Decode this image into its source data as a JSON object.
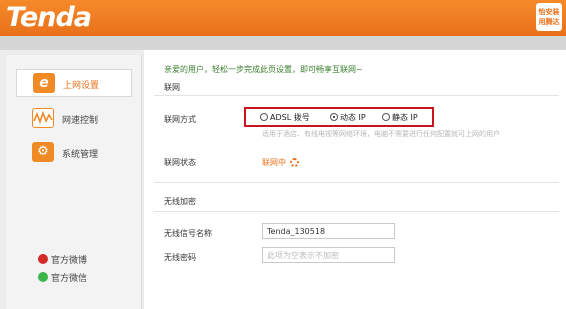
{
  "header": {
    "logo": "Tenda",
    "badge_line1": "怡安装",
    "badge_line2": "用腾达"
  },
  "sidebar": {
    "items": [
      {
        "label": "上网设置",
        "icon": "internet-e-icon",
        "active": true
      },
      {
        "label": "网速控制",
        "icon": "speed-wave-icon",
        "active": false
      },
      {
        "label": "系统管理",
        "icon": "gear-icon",
        "active": false
      }
    ],
    "social": [
      {
        "label": "官方微博",
        "icon": "weibo-icon",
        "color": "#d52a2a"
      },
      {
        "label": "官方微信",
        "icon": "wechat-icon",
        "color": "#3bb54a"
      }
    ]
  },
  "main": {
    "greeting": "亲爱的用户，轻松一步完成此页设置，即可畅享互联网~",
    "internet_section": "联网",
    "connection_label": "联网方式",
    "options": [
      {
        "label": "ADSL 拨号",
        "selected": false
      },
      {
        "label": "动态 IP",
        "selected": true
      },
      {
        "label": "静态 IP",
        "selected": false
      }
    ],
    "hint": "适用于酒店、有线电视等网络环境，电脑不需要进行任何配置就可上网的用户",
    "status_label": "联网状态",
    "status_value": "联网中",
    "wireless_section": "无线加密",
    "ssid_label": "无线信号名称",
    "ssid_value": "Tenda_130518",
    "password_label": "无线密码",
    "password_placeholder": "此项为空表示不加密"
  },
  "colors": {
    "brand": "#e9701a",
    "highlight_border": "#c8141c",
    "greeting": "#3a7e2e"
  }
}
